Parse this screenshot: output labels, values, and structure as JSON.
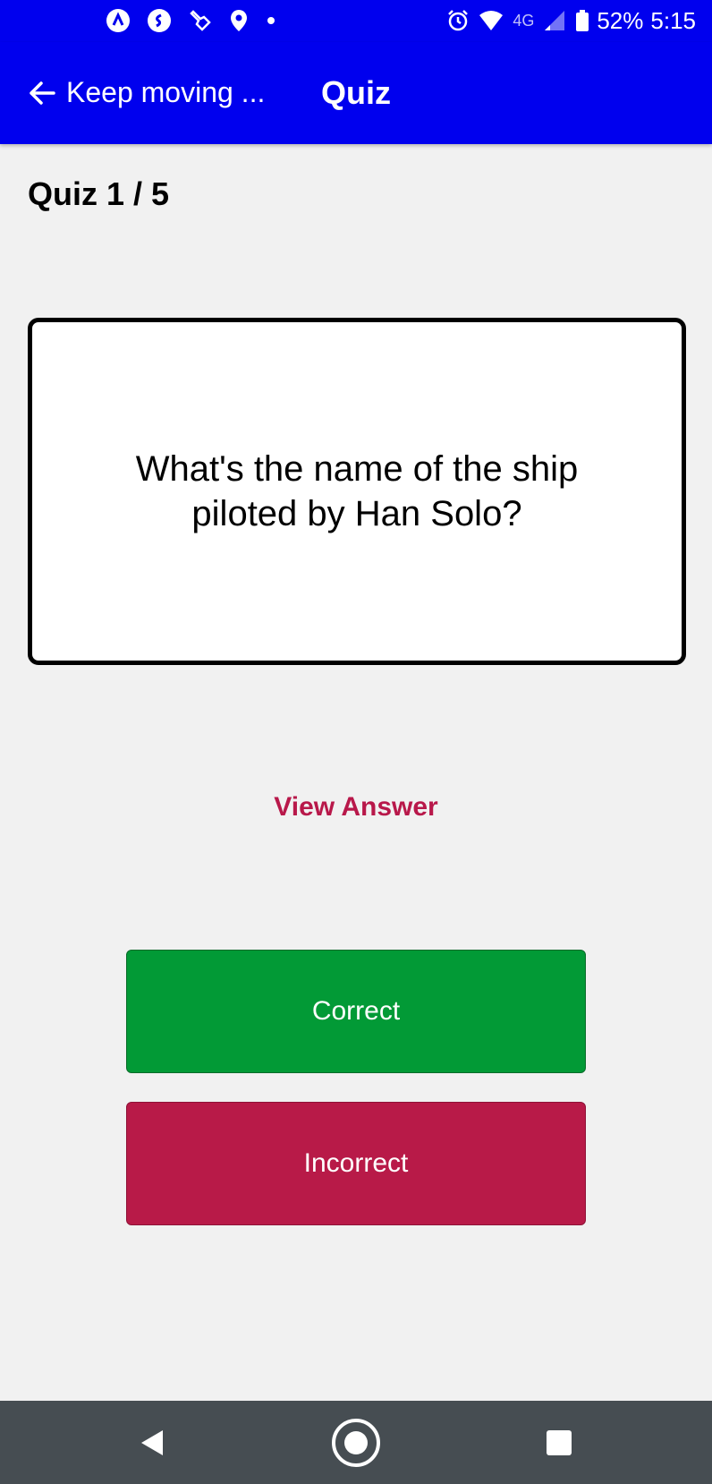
{
  "status_bar": {
    "network": "4G",
    "battery": "52%",
    "time": "5:15",
    "left_icons": [
      "navigation-app-icon",
      "shazam-icon",
      "tool-icon",
      "location-pin-icon",
      "notification-dot-icon"
    ],
    "right_icons": [
      "alarm-icon",
      "wifi-icon",
      "signal-icon",
      "battery-icon"
    ]
  },
  "app_bar": {
    "back_label": "Keep moving ...",
    "title": "Quiz"
  },
  "quiz": {
    "progress": "Quiz 1 / 5",
    "question": "What's the name of the ship piloted by Han Solo?",
    "view_answer": "View Answer",
    "correct_label": "Correct",
    "incorrect_label": "Incorrect"
  },
  "colors": {
    "header": "#0000ee",
    "accent": "#b8184a",
    "correct": "#029a36",
    "incorrect": "#b81a48",
    "nav_bar": "#464d52"
  }
}
